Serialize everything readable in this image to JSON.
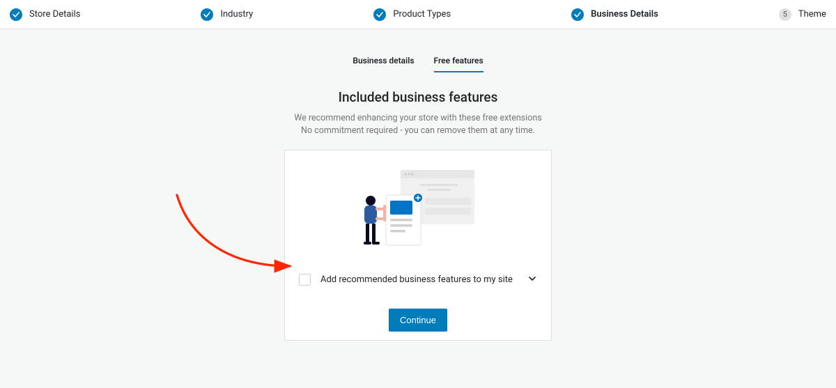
{
  "stepper": {
    "steps": [
      {
        "label": "Store Details",
        "state": "done"
      },
      {
        "label": "Industry",
        "state": "done"
      },
      {
        "label": "Product Types",
        "state": "done"
      },
      {
        "label": "Business Details",
        "state": "active-done"
      },
      {
        "label": "Theme",
        "state": "upcoming",
        "num": "5"
      }
    ]
  },
  "tabs": {
    "business": "Business details",
    "free": "Free features"
  },
  "headline": {
    "title": "Included business features",
    "sub1": "We recommend enhancing your store with these free extensions",
    "sub2": "No commitment required - you can remove them at any time."
  },
  "row": {
    "label": "Add recommended business features to my site"
  },
  "buttons": {
    "continue": "Continue"
  }
}
